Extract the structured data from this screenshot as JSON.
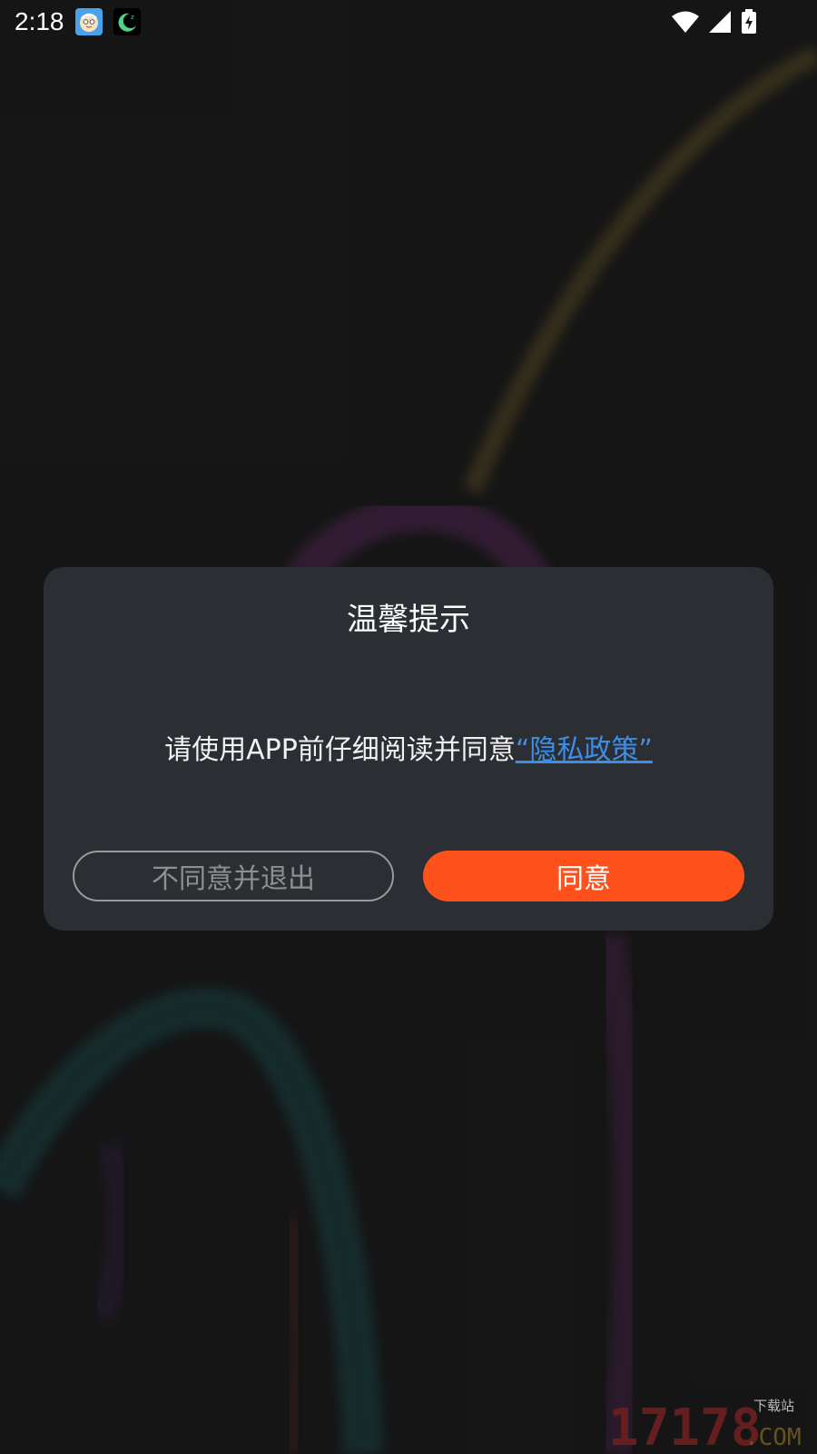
{
  "status_bar": {
    "time": "2:18",
    "icons": [
      "baby-app-icon",
      "sleep-app-icon",
      "wifi-icon",
      "cell-signal-icon",
      "battery-charging-icon"
    ]
  },
  "dialog": {
    "title": "温馨提示",
    "message_prefix": "请使用APP前仔细阅读并同意",
    "policy_link": "“隐私政策”",
    "decline_label": "不同意并退出",
    "agree_label": "同意"
  },
  "watermark": {
    "brand_number": "17178",
    "brand_suffix": ".COM",
    "tagline": "下载站"
  },
  "colors": {
    "accent": "#ff511c",
    "link": "#3d8ee8",
    "dialog_bg": "#2b2e33",
    "page_bg": "#1b1b1b"
  }
}
